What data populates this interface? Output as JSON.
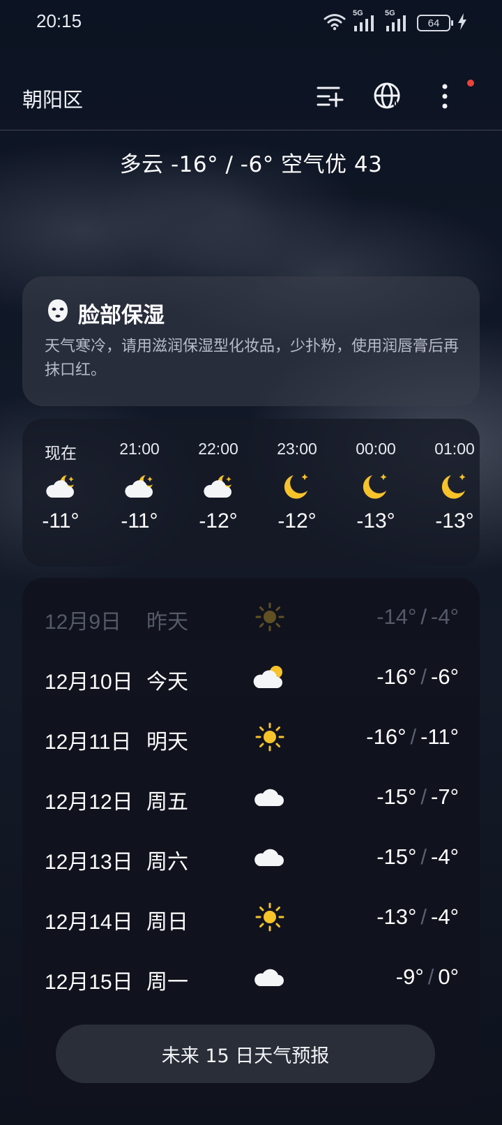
{
  "status_bar": {
    "time": "20:15",
    "battery": "64",
    "icons": [
      "wifi-icon",
      "5g-signal-icon",
      "5g-signal-icon",
      "battery-icon",
      "charging-icon"
    ],
    "net_label": "5G"
  },
  "header": {
    "location": "朝阳区",
    "icons": [
      "manage-cities-icon",
      "globe-icon",
      "more-icon"
    ]
  },
  "summary": "多云  -16° / -6°  空气优 43",
  "tip": {
    "icon": "face-mask-icon",
    "title": "脸部保湿",
    "text": "天气寒冷，请用滋润保湿型化妆品，少扑粉，使用润唇膏后再抹口红。"
  },
  "hourly": [
    {
      "time": "现在",
      "icon": "cloudy-night-icon",
      "temp": "-11°"
    },
    {
      "time": "21:00",
      "icon": "cloudy-night-icon",
      "temp": "-11°"
    },
    {
      "time": "22:00",
      "icon": "cloudy-night-icon",
      "temp": "-12°"
    },
    {
      "time": "23:00",
      "icon": "moon-icon",
      "temp": "-12°"
    },
    {
      "time": "00:00",
      "icon": "moon-icon",
      "temp": "-13°"
    },
    {
      "time": "01:00",
      "icon": "moon-icon",
      "temp": "-13°"
    }
  ],
  "daily": [
    {
      "date": "12月9日",
      "day": "昨天",
      "icon": "sunny-icon",
      "low": "-14°",
      "high": "-4°",
      "past": true
    },
    {
      "date": "12月10日",
      "day": "今天",
      "icon": "partly-cloudy-icon",
      "low": "-16°",
      "high": "-6°"
    },
    {
      "date": "12月11日",
      "day": "明天",
      "icon": "sunny-icon",
      "low": "-16°",
      "high": "-11°"
    },
    {
      "date": "12月12日",
      "day": "周五",
      "icon": "cloudy-icon",
      "low": "-15°",
      "high": "-7°"
    },
    {
      "date": "12月13日",
      "day": "周六",
      "icon": "cloudy-icon",
      "low": "-15°",
      "high": "-4°"
    },
    {
      "date": "12月14日",
      "day": "周日",
      "icon": "sunny-icon",
      "low": "-13°",
      "high": "-4°"
    },
    {
      "date": "12月15日",
      "day": "周一",
      "icon": "cloudy-icon",
      "low": "-9°",
      "high": "0°"
    }
  ],
  "forecast_button": "未来 15 日天气预报",
  "colors": {
    "sun": "#f6c32a",
    "moon": "#f6c32a",
    "cloud": "#f4f5f7",
    "notification": "#e8443a"
  }
}
